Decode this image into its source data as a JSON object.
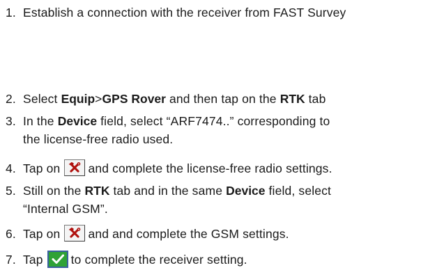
{
  "steps": [
    {
      "number": "1.",
      "segments": [
        {
          "text": "Establish a connection with the receiver from FAST Survey",
          "bold": false
        }
      ]
    },
    {
      "number": "2.",
      "segments": [
        {
          "text": "Select ",
          "bold": false
        },
        {
          "text": "Equip",
          "bold": true
        },
        {
          "text": ">",
          "bold": false
        },
        {
          "text": "GPS Rover",
          "bold": true
        },
        {
          "text": " and then tap on the ",
          "bold": false
        },
        {
          "text": "RTK",
          "bold": true
        },
        {
          "text": " tab",
          "bold": false
        }
      ]
    },
    {
      "number": "3.",
      "segments": [
        {
          "text": "In the ",
          "bold": false
        },
        {
          "text": "Device",
          "bold": true
        },
        {
          "text": " field, select “ARF7474..” corresponding to",
          "bold": false
        }
      ],
      "continuation": "the license-free radio used."
    },
    {
      "number": "4.",
      "before_icon": "Tap on",
      "after_icon": "and complete the license-free radio settings."
    },
    {
      "number": "5.",
      "segments": [
        {
          "text": "Still on the ",
          "bold": false
        },
        {
          "text": "RTK",
          "bold": true
        },
        {
          "text": " tab and in the same ",
          "bold": false
        },
        {
          "text": "Device",
          "bold": true
        },
        {
          "text": " field, select",
          "bold": false
        }
      ],
      "continuation": "“Internal GSM”."
    },
    {
      "number": "6.",
      "before_icon": "Tap on",
      "after_icon": "and and complete the GSM settings."
    },
    {
      "number": "7.",
      "before_icon": "Tap",
      "after_icon": "to complete the receiver setting."
    }
  ],
  "icons": {
    "settings_tool": "tools-icon",
    "confirm": "checkmark-icon",
    "check_color": "#2fa236",
    "check_border": "#3a5f9f"
  }
}
